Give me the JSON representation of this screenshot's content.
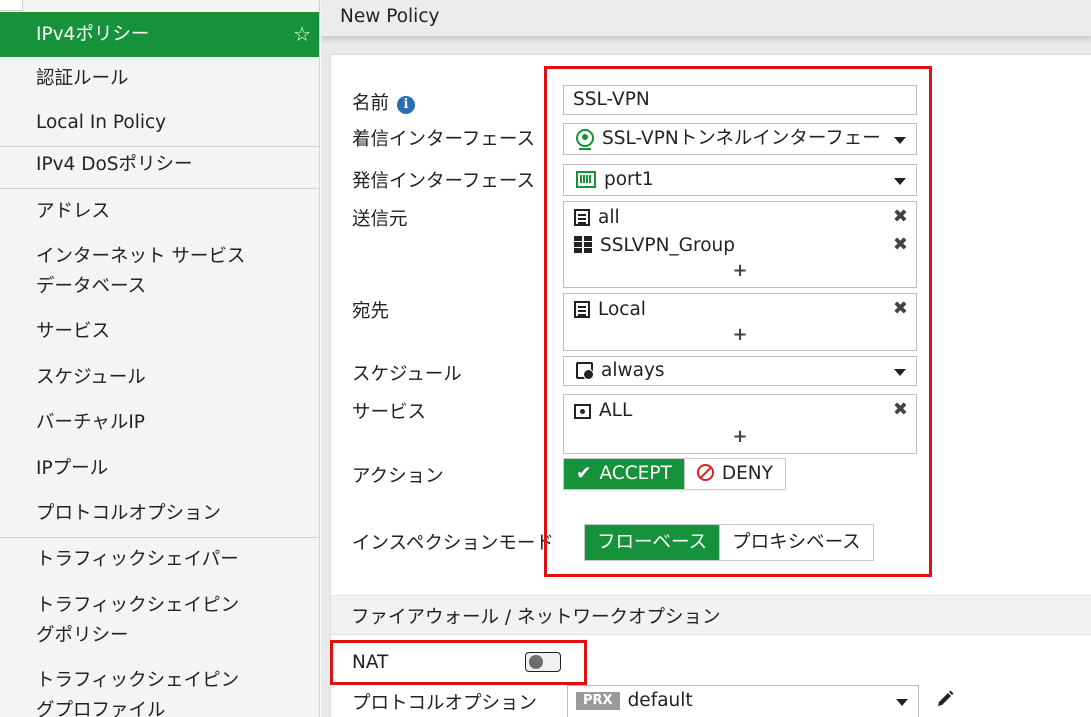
{
  "sidebar": {
    "items": [
      {
        "label": "IPv4ポリシー",
        "active": true
      },
      {
        "label": "認証ルール"
      },
      {
        "label": "Local In Policy"
      },
      {
        "label": "IPv4 DoSポリシー"
      },
      {
        "label": "アドレス"
      },
      {
        "label": "インターネット サービス"
      },
      {
        "label": "データベース"
      },
      {
        "label": "サービス"
      },
      {
        "label": "スケジュール"
      },
      {
        "label": "バーチャルIP"
      },
      {
        "label": "IPプール"
      },
      {
        "label": "プロトコルオプション"
      },
      {
        "label": "トラフィックシェイパー"
      },
      {
        "label": "トラフィックシェイピン"
      },
      {
        "label": "グポリシー"
      },
      {
        "label": "トラフィックシェイピン"
      },
      {
        "label": "グプロファイル"
      }
    ],
    "favorite_icon": "star-icon"
  },
  "header": {
    "title": "New Policy"
  },
  "form": {
    "name": {
      "label": "名前",
      "value": "SSL-VPN",
      "info_icon": "info-icon"
    },
    "incoming_interface": {
      "label": "着信インターフェース",
      "value": "SSL-VPNトンネルインターフェー",
      "icon": "ssl-vpn-tunnel-icon"
    },
    "outgoing_interface": {
      "label": "発信インターフェース",
      "value": "port1",
      "icon": "port-icon"
    },
    "source": {
      "label": "送信元",
      "entries": [
        {
          "value": "all",
          "icon": "address-icon"
        },
        {
          "value": "SSLVPN_Group",
          "icon": "user-group-icon"
        }
      ],
      "add": "+",
      "remove": "✖"
    },
    "destination": {
      "label": "宛先",
      "entries": [
        {
          "value": "Local",
          "icon": "address-icon"
        }
      ],
      "add": "+",
      "remove": "✖"
    },
    "schedule": {
      "label": "スケジュール",
      "value": "always",
      "icon": "schedule-icon"
    },
    "service": {
      "label": "サービス",
      "entries": [
        {
          "value": "ALL",
          "icon": "service-icon"
        }
      ],
      "add": "+",
      "remove": "✖"
    },
    "action": {
      "label": "アクション",
      "accept": "ACCEPT",
      "deny": "DENY",
      "selected": "ACCEPT"
    },
    "inspection_mode": {
      "label": "インスペクションモード",
      "flow": "フローベース",
      "proxy": "プロキシベース",
      "selected": "フローベース"
    },
    "section_title": "ファイアウォール / ネットワークオプション",
    "nat": {
      "label": "NAT",
      "enabled": false
    },
    "protocol_options": {
      "label": "プロトコルオプション",
      "badge": "PRX",
      "value": "default"
    }
  },
  "colors": {
    "accent": "#16923a",
    "highlight": "#e01010",
    "deny": "#dd2222"
  }
}
